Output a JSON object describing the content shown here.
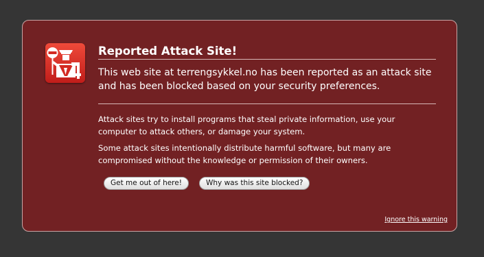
{
  "colors": {
    "window_background": "#353535",
    "panel_background": "#722123",
    "icon_background": "#d83228",
    "text": "#ffffff"
  },
  "warning": {
    "icon": "police-officer-stop-sign-icon",
    "title": "Reported Attack Site!",
    "lead_lines": [
      "This web site at terrengsykkel.no has been reported as an attack site",
      "and has been blocked based on your security preferences."
    ],
    "paragraph1_lines": [
      "Attack sites try to install programs that steal private information, use your",
      "computer to attack others, or damage your system."
    ],
    "paragraph2_lines": [
      "Some attack sites intentionally distribute harmful software, but many are",
      "compromised without the knowledge or permission of their owners."
    ]
  },
  "buttons": {
    "get_me_out": "Get me out of here!",
    "why_blocked": "Why was this site blocked?"
  },
  "ignore_link": "Ignore this warning"
}
